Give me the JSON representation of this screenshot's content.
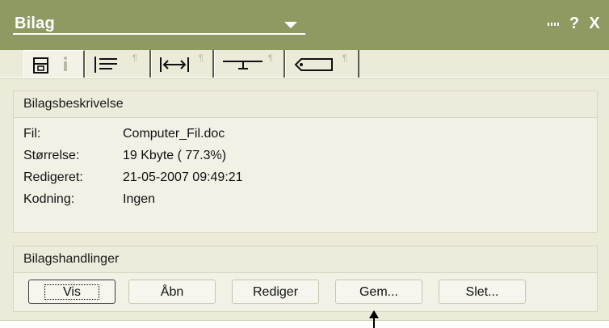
{
  "titlebar": {
    "title": "Bilag",
    "help": "?",
    "close": "X"
  },
  "tabs": [
    {
      "icon": "file-info-icon",
      "active": true
    },
    {
      "icon": "paragraph-align-icon",
      "active": false
    },
    {
      "icon": "width-arrows-icon",
      "active": false
    },
    {
      "icon": "tab-stop-icon",
      "active": false
    },
    {
      "icon": "tag-label-icon",
      "active": false
    }
  ],
  "description_section": {
    "heading": "Bilagsbeskrivelse",
    "rows": [
      {
        "label": "Fil:",
        "value": "Computer_Fil.doc"
      },
      {
        "label": "Størrelse:",
        "value": "19 Kbyte ( 77.3%)"
      },
      {
        "label": "Redigeret:",
        "value": "21-05-2007 09:49:21"
      },
      {
        "label": "Kodning:",
        "value": "Ingen"
      }
    ]
  },
  "actions_section": {
    "heading": "Bilagshandlinger",
    "buttons": {
      "view": "Vis",
      "open": "Åbn",
      "edit": "Rediger",
      "save": "Gem...",
      "delete": "Slet..."
    }
  },
  "colors": {
    "titlebar": "#8d9b62",
    "panel": "#ecead8"
  }
}
